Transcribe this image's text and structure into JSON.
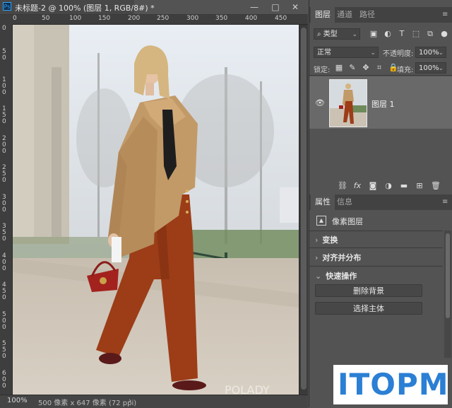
{
  "document": {
    "app_icon": "Ps",
    "title": "未标题-2 @ 100% (图层 1, RGB/8#) *",
    "window_buttons": [
      "—",
      "□",
      "✕"
    ],
    "ruler_h": [
      "0",
      "50",
      "100",
      "150",
      "200",
      "250",
      "300",
      "350",
      "400",
      "450"
    ],
    "ruler_v": [
      "0",
      "5 0",
      "1 0 0",
      "1 5 0",
      "2 0 0",
      "2 5 0",
      "3 0 0",
      "3 5 0",
      "4 0 0",
      "4 5 0",
      "5 0 0",
      "5 5 0",
      "6 0 0"
    ],
    "canvas_watermark": "POLADY"
  },
  "statusbar": {
    "zoom": "100%",
    "info": "500 像素 x 647 像素 (72 ppi)",
    "arrow": "›"
  },
  "layers_panel": {
    "tabs": [
      "图层",
      "通道",
      "路径"
    ],
    "filter_label": "类型",
    "blend_mode": "正常",
    "opacity_label": "不透明度:",
    "opacity_value": "100%",
    "lock_label": "锁定:",
    "fill_label": "填充:",
    "fill_value": "100%",
    "layer_name": "图层 1"
  },
  "properties_panel": {
    "tabs": [
      "属性",
      "信息"
    ],
    "layer_type": "像素图层",
    "sections": [
      "变换",
      "对齐并分布",
      "快速操作"
    ],
    "buttons": [
      "删除背景",
      "选择主体"
    ]
  },
  "watermark": {
    "text": "ITOPM"
  },
  "colors": {
    "accent": "#31a8ff",
    "panel": "#535353",
    "selected_layer": "#696969",
    "watermark": "#2b7fd4"
  }
}
